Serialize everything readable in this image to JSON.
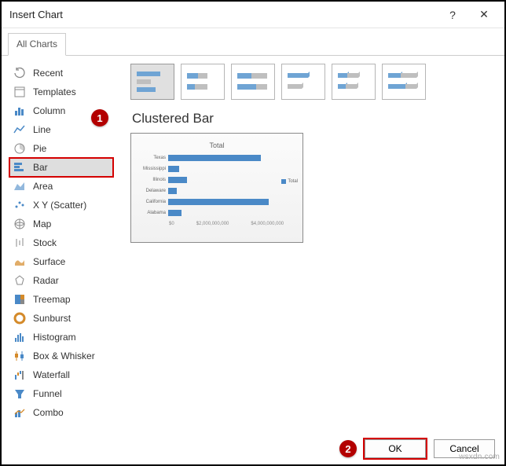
{
  "dialog": {
    "title": "Insert Chart",
    "help_symbol": "?",
    "close_symbol": "✕",
    "tab": "All Charts",
    "ok_label": "OK",
    "cancel_label": "Cancel"
  },
  "markers": {
    "one": "1",
    "two": "2"
  },
  "sidebar": {
    "items": [
      {
        "label": "Recent",
        "icon": "recent"
      },
      {
        "label": "Templates",
        "icon": "templates"
      },
      {
        "label": "Column",
        "icon": "column"
      },
      {
        "label": "Line",
        "icon": "line"
      },
      {
        "label": "Pie",
        "icon": "pie"
      },
      {
        "label": "Bar",
        "icon": "bar",
        "selected": true
      },
      {
        "label": "Area",
        "icon": "area"
      },
      {
        "label": "X Y (Scatter)",
        "icon": "scatter"
      },
      {
        "label": "Map",
        "icon": "map"
      },
      {
        "label": "Stock",
        "icon": "stock"
      },
      {
        "label": "Surface",
        "icon": "surface"
      },
      {
        "label": "Radar",
        "icon": "radar"
      },
      {
        "label": "Treemap",
        "icon": "treemap"
      },
      {
        "label": "Sunburst",
        "icon": "sunburst"
      },
      {
        "label": "Histogram",
        "icon": "histogram"
      },
      {
        "label": "Box & Whisker",
        "icon": "box"
      },
      {
        "label": "Waterfall",
        "icon": "waterfall"
      },
      {
        "label": "Funnel",
        "icon": "funnel"
      },
      {
        "label": "Combo",
        "icon": "combo"
      }
    ]
  },
  "content": {
    "subtitle": "Clustered Bar",
    "preview_title": "Total",
    "legend": "Total",
    "xaxis": [
      "$0",
      "$2,000,000,000",
      "$4,000,000,000"
    ]
  },
  "chart_data": {
    "type": "bar",
    "title": "Total",
    "orientation": "horizontal",
    "categories": [
      "Texas",
      "Mississippi",
      "Illinois",
      "Delaware",
      "California",
      "Alabama"
    ],
    "series": [
      {
        "name": "Total",
        "values": [
          3800000000,
          400000000,
          700000000,
          300000000,
          4100000000,
          500000000
        ]
      }
    ],
    "xlabel": "",
    "ylabel": "",
    "xlim": [
      0,
      4500000000
    ],
    "xticks": [
      0,
      2000000000,
      4000000000
    ],
    "legend_position": "right"
  },
  "watermark": "wsxdn.com"
}
